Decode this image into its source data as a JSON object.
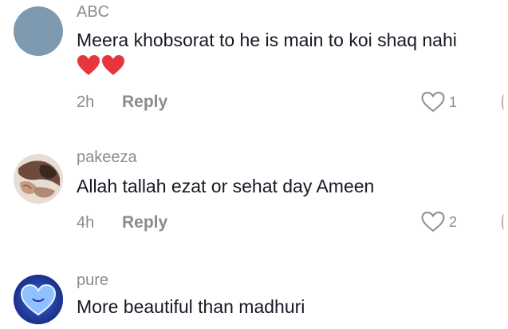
{
  "comments": [
    {
      "username": "ABC",
      "text": "Meera khobsorat to he is main to koi shaq nahi",
      "emoji": [
        "red-heart",
        "red-heart"
      ],
      "time": "2h",
      "reply_label": "Reply",
      "likes": "1"
    },
    {
      "username": "pakeeza",
      "text": "Allah tallah ezat or sehat day Ameen",
      "time": "4h",
      "reply_label": "Reply",
      "likes": "2"
    },
    {
      "username": "pure",
      "text": "More beautiful than madhuri"
    }
  ],
  "colors": {
    "secondary_text": "#8a8b91",
    "primary_text": "#161823",
    "heart_red": "#e8343b",
    "avatar1": "#7d9ab0",
    "avatar3": "#1d3aa6"
  }
}
